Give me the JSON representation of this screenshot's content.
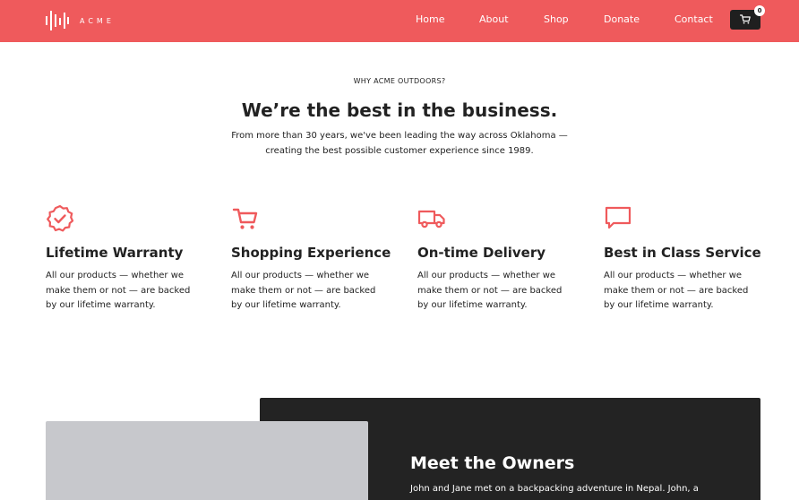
{
  "header": {
    "brand": "ACME",
    "nav": [
      "Home",
      "About",
      "Shop",
      "Donate",
      "Contact"
    ],
    "cart_count": "0",
    "cart_icon": "cart-icon",
    "logo_icon": "sound-bars-logo",
    "accent_color": "#EF5A5C",
    "dark_color": "#232323"
  },
  "intro": {
    "eyebrow": "WHY ACME OUTDOORS?",
    "headline": "We’re the best in the business.",
    "text": "From more than 30 years, we've been leading the way across Oklahoma — creating the best possible customer experience since 1989."
  },
  "features": [
    {
      "icon": "badge-check-icon",
      "title": "Lifetime Warranty",
      "text": "All our products — whether we make them or not — are backed by our lifetime warranty."
    },
    {
      "icon": "cart-icon",
      "title": "Shopping Experience",
      "text": "All our products — whether we make them or not — are backed by our lifetime warranty."
    },
    {
      "icon": "truck-icon",
      "title": "On-time Delivery",
      "text": "All our products — whether we make them or not — are backed by our lifetime warranty."
    },
    {
      "icon": "chat-icon",
      "title": "Best in Class Service",
      "text": "All our products — whether we make them or not — are backed by our lifetime warranty."
    }
  ],
  "owners": {
    "title": "Meet the Owners",
    "text": "John and Jane met on a backpacking adventure in Nepal. John, a"
  }
}
